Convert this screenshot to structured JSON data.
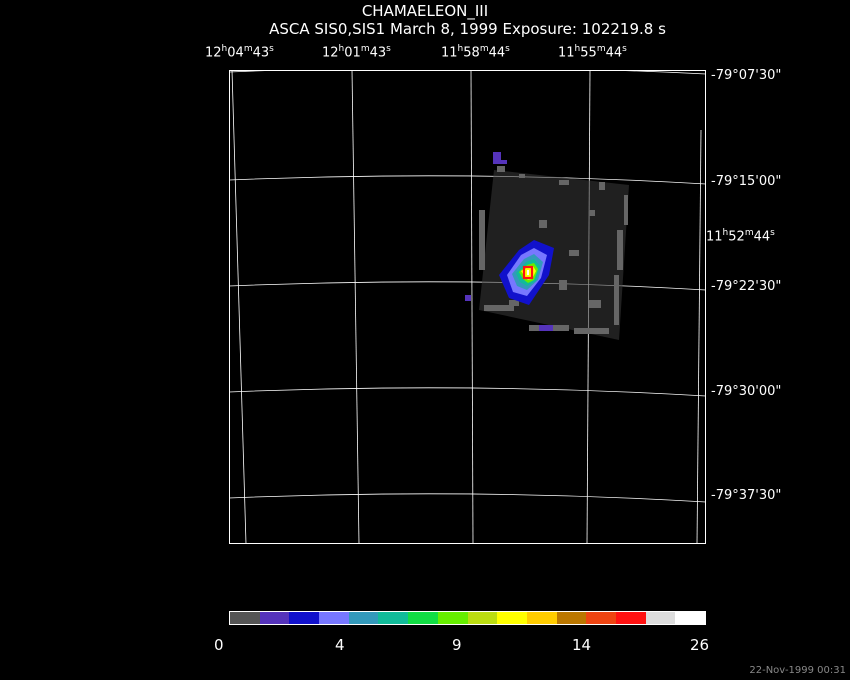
{
  "title": "CHAMAELEON_III",
  "subtitle": "ASCA SIS0,SIS1 March 8, 1999 Exposure: 102219.8 s",
  "ra_labels": [
    {
      "h": "12",
      "m": "04",
      "s": "43"
    },
    {
      "h": "12",
      "m": "01",
      "s": "43"
    },
    {
      "h": "11",
      "m": "58",
      "s": "44"
    },
    {
      "h": "11",
      "m": "55",
      "s": "44"
    }
  ],
  "ra_side": {
    "h": "11",
    "m": "52",
    "s": "44"
  },
  "dec_labels": [
    "-79°07'30\"",
    "-79°15'00\"",
    "-79°22'30\"",
    "-79°30'00\"",
    "-79°37'30\""
  ],
  "colorbar": {
    "colors": [
      "#555555",
      "#5533bb",
      "#1111cc",
      "#7777ff",
      "#3399bb",
      "#11bb99",
      "#11dd44",
      "#66ee00",
      "#bbdd11",
      "#ffff00",
      "#ffcc00",
      "#bb7700",
      "#ee4411",
      "#ff1111",
      "#dddddd",
      "#ffffff"
    ],
    "labels": [
      "0",
      "4",
      "9",
      "14",
      "26"
    ]
  },
  "timestamp": "22-Nov-1999 00:31"
}
